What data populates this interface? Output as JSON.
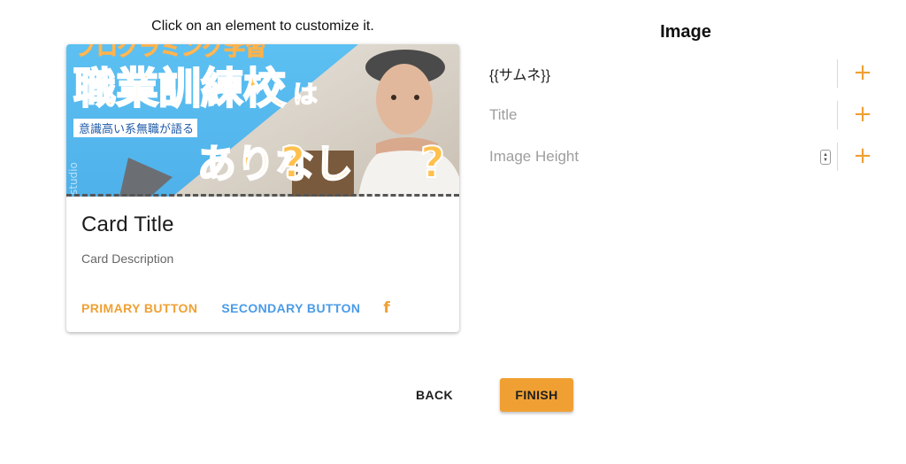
{
  "hint_text": "Click on an element to customize it.",
  "card": {
    "image": {
      "alt": "thumbnail",
      "headline": "職業訓練校",
      "headline_suffix": "は",
      "top_strip": "プログラミング学習",
      "tag": "意識高い系無職が語る",
      "question": "ありなし",
      "watermark": "studio"
    },
    "title": "Card Title",
    "description": "Card Description",
    "primary_button": "PRIMARY BUTTON",
    "secondary_button": "SECONDARY BUTTON",
    "social_icon": "facebook-icon",
    "social_glyph": "f"
  },
  "panel": {
    "title": "Image",
    "fields": [
      {
        "label": "{{サムネ}}",
        "kind": "text",
        "has_value": true
      },
      {
        "label": "Title",
        "kind": "text",
        "has_value": false
      },
      {
        "label": "Image Height",
        "kind": "number",
        "has_value": false
      }
    ],
    "add_icon": "plus-icon",
    "add_glyph": "+"
  },
  "footer": {
    "back_label": "BACK",
    "finish_label": "FINISH"
  },
  "colors": {
    "accent": "#f0a033",
    "secondary": "#4a9be8",
    "sky": "#55b9ef"
  }
}
